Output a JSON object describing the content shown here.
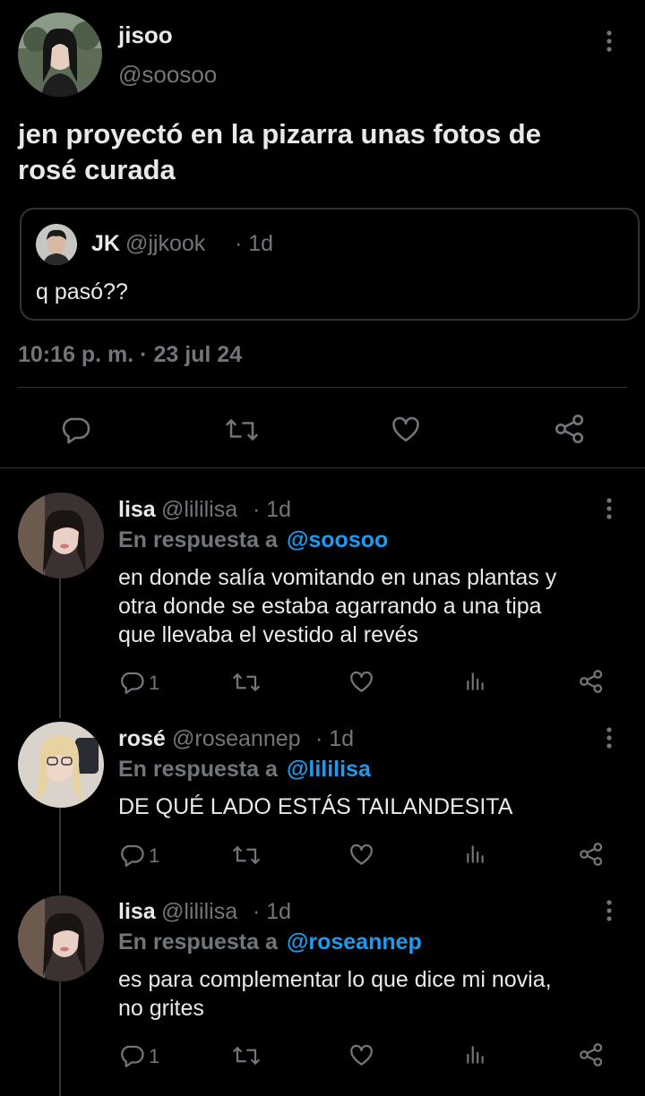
{
  "main_tweet": {
    "author_name": "jisoo",
    "author_handle": "@soosoo",
    "text_line1": "jen proyectó en la pizarra unas fotos de",
    "text_line2": "rosé curada",
    "quote": {
      "name": "JK",
      "handle": "@jjkook",
      "time": "· 1d",
      "text": "q pasó??"
    },
    "timestamp": "10:16 p. m. · 23 jul 24"
  },
  "replies": [
    {
      "name": "lisa",
      "handle": "@lililisa",
      "time": "· 1d",
      "reply_prefix": "En respuesta a",
      "reply_to": "@soosoo",
      "lines": [
        "en donde salía vomitando en unas plantas y",
        "otra donde se estaba agarrando a una tipa",
        "que llevaba el vestido al revés"
      ],
      "reply_count": "1"
    },
    {
      "name": "rosé",
      "handle": "@roseannep",
      "time": "· 1d",
      "reply_prefix": "En respuesta a",
      "reply_to": "@lililisa",
      "lines": [
        "DE QUÉ LADO ESTÁS TAILANDESITA"
      ],
      "reply_count": "1"
    },
    {
      "name": "lisa",
      "handle": "@lililisa",
      "time": "· 1d",
      "reply_prefix": "En respuesta a",
      "reply_to": "@roseannep",
      "lines": [
        "es para complementar lo que dice mi novia,",
        "no grites"
      ],
      "reply_count": "1"
    }
  ],
  "colors": {
    "background": "#000000",
    "text": "#e7e9ea",
    "muted": "#71767b",
    "link": "#1d9bf0",
    "divider": "#2f3336"
  }
}
